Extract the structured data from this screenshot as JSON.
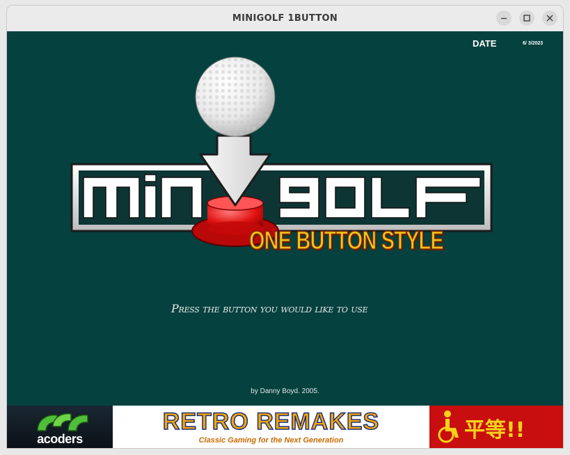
{
  "window": {
    "title": "MINIGOLF 1BUTTON",
    "controls": [
      "minimize",
      "maximize",
      "close"
    ]
  },
  "hud": {
    "date_label": "DATE",
    "date_value": "6/ 3/2023"
  },
  "logo": {
    "title": "MiNiGOLF",
    "subtitle": "ONE BUTTON STYLE"
  },
  "prompt": "Press the button you would like to use",
  "credit": "by Danny Boyd. 2005.",
  "banner": {
    "acoders": "acoders",
    "retro_title": "RETRO REMAKES",
    "retro_sub": "Classic Gaming for the Next Generation",
    "equal_text": "平等!!"
  },
  "colors": {
    "game_bg": "#04413f",
    "subtitle": "#f2c21a",
    "banner_red": "#c80e0e"
  }
}
